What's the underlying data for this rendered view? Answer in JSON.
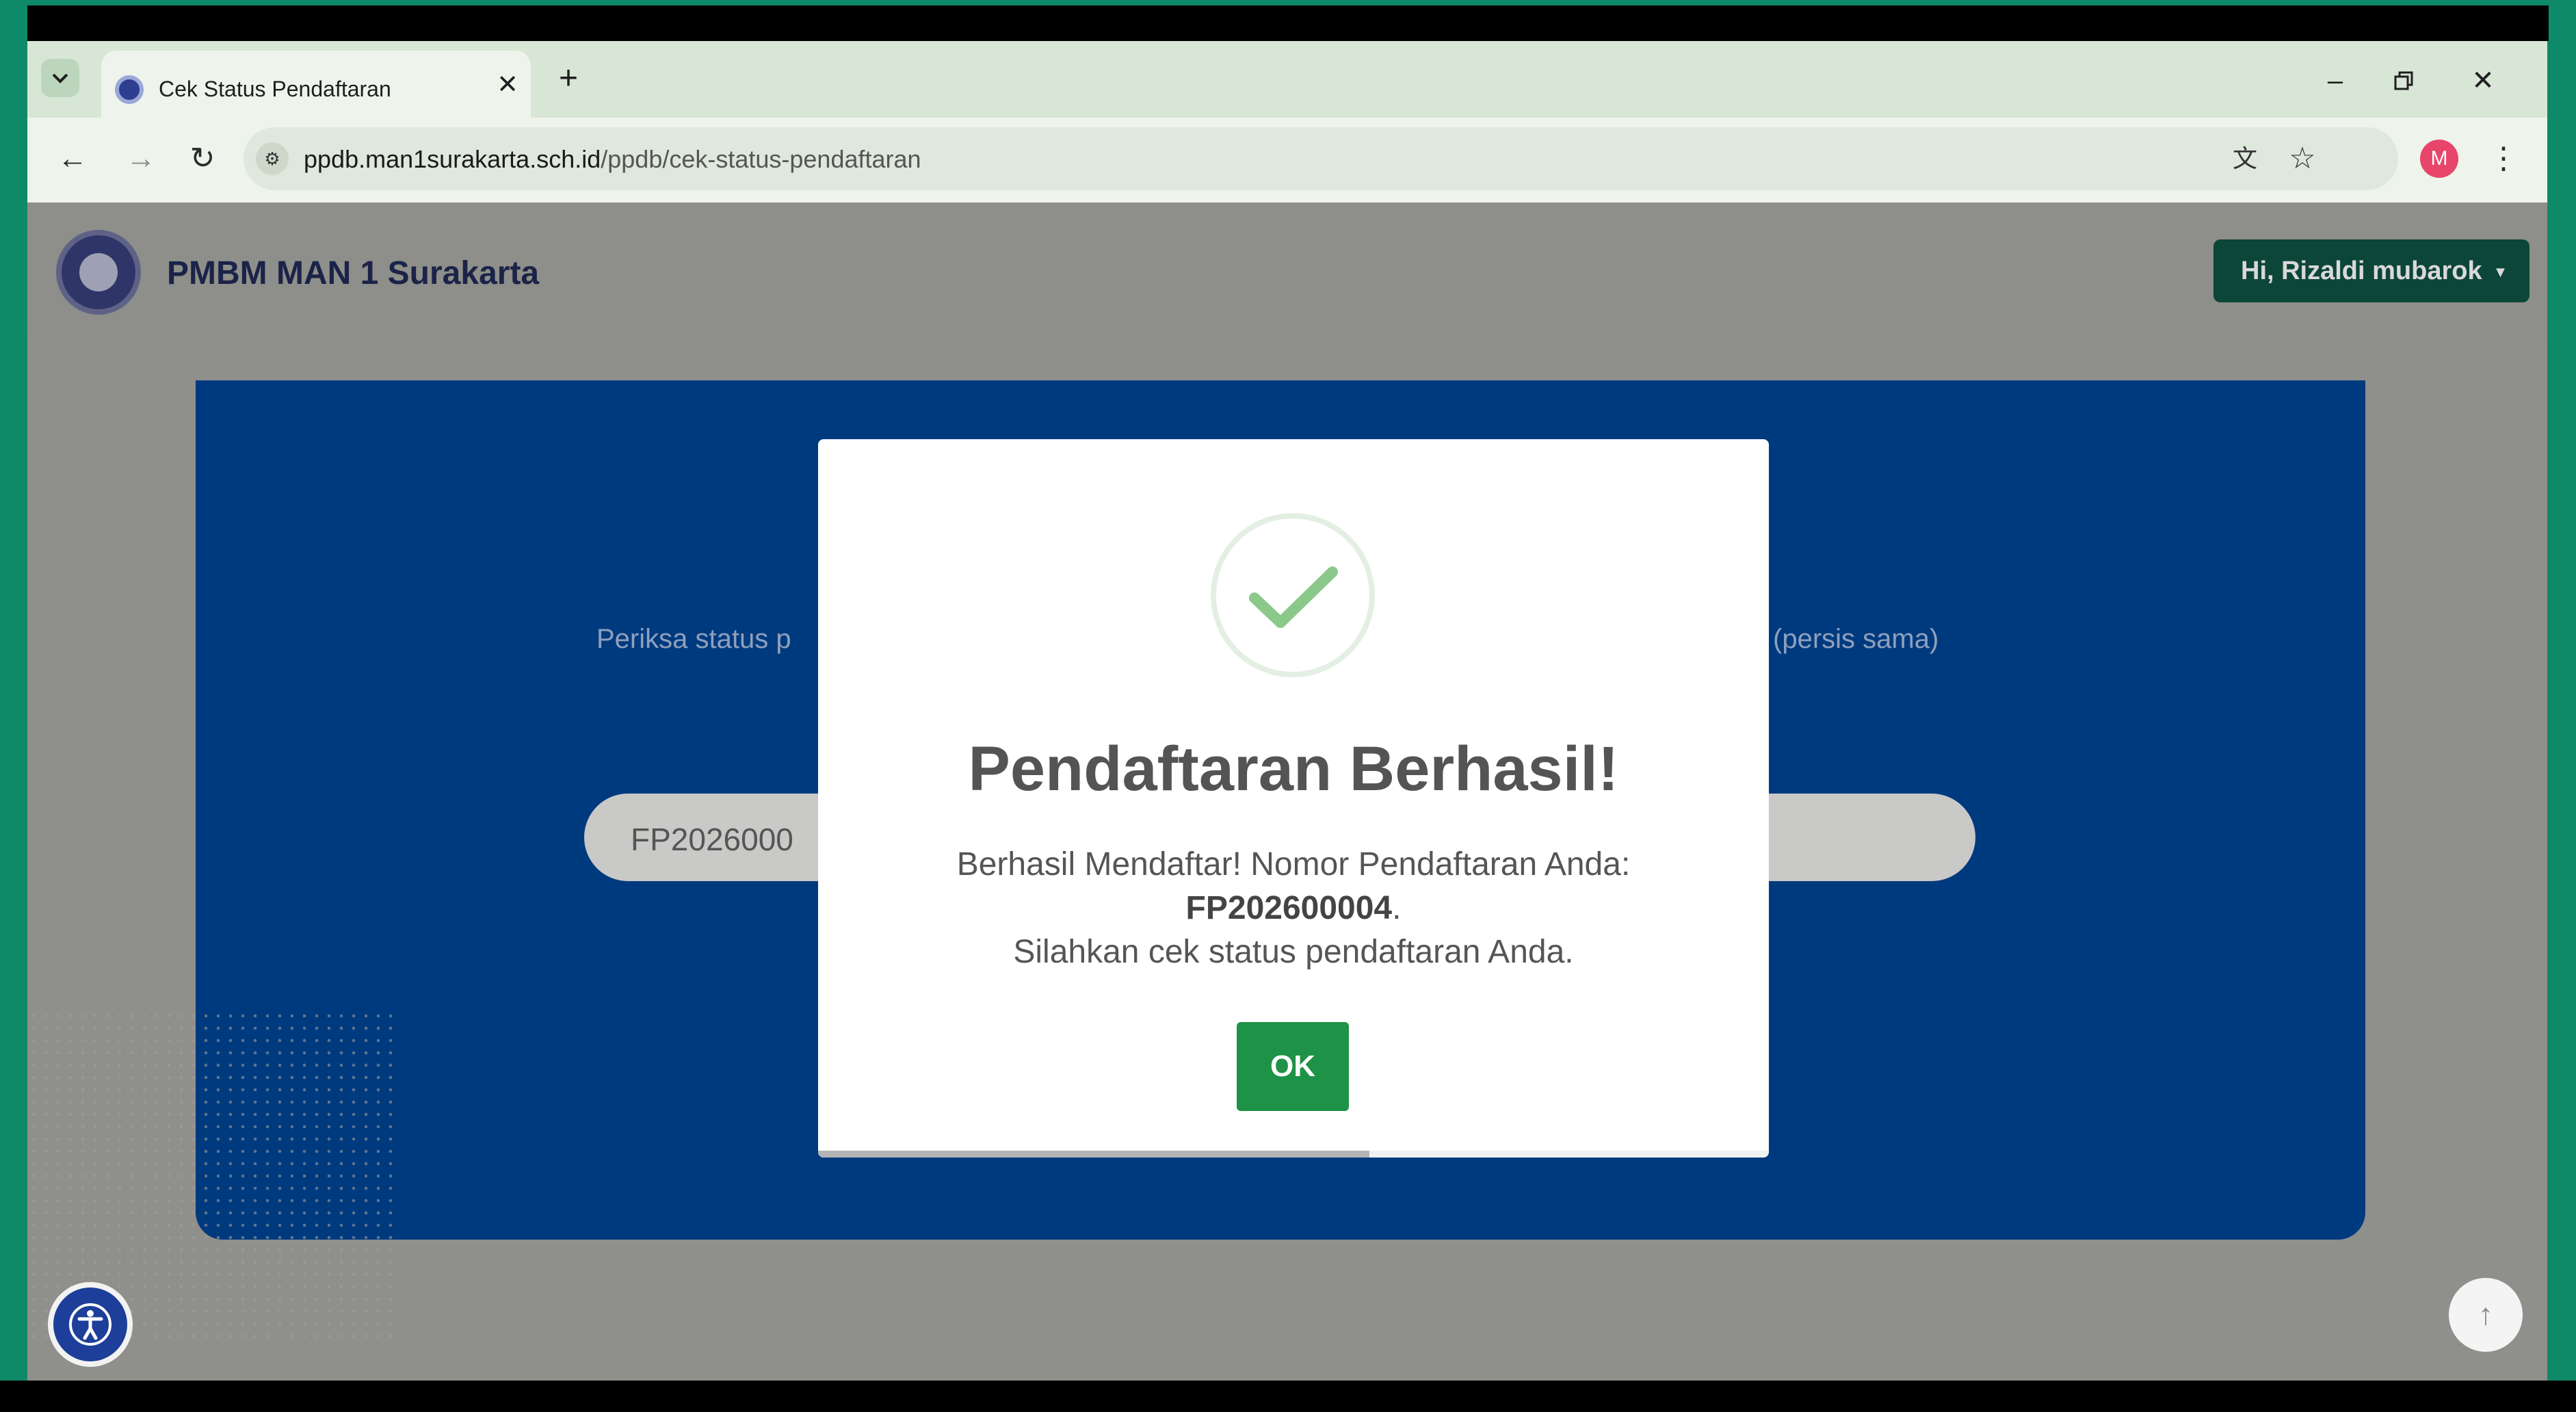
{
  "browser": {
    "tab_title": "Cek Status Pendaftaran",
    "url_host": "ppdb.man1surakarta.sch.id",
    "url_path": "/ppdb/cek-status-pendaftaran",
    "profile_initial": "M"
  },
  "site": {
    "brand": "PMBM MAN 1 Surakarta",
    "user_menu_label": "Hi, Rizaldi mubarok"
  },
  "hero": {
    "description_left": "Periksa status p",
    "description_right": "(persis sama)",
    "search_value": "FP2026000"
  },
  "modal": {
    "title": "Pendaftaran Berhasil!",
    "message_line1": "Berhasil Mendaftar! Nomor Pendaftaran Anda:",
    "registration_number": "FP202600004",
    "message_line2_suffix": ".",
    "message_line3": "Silahkan cek status pendaftaran Anda.",
    "ok_label": "OK",
    "timer_progress_percent": 58
  },
  "icons": {
    "tab_menu": "chevron-down-icon",
    "favicon": "school-emblem-icon",
    "close_tab": "close-icon",
    "new_tab": "plus-icon",
    "minimize": "minimize-icon",
    "restore": "restore-icon",
    "close_window": "close-icon",
    "back": "arrow-left-icon",
    "forward": "arrow-right-icon",
    "reload": "reload-icon",
    "site_info": "tune-icon",
    "translate": "translate-icon",
    "bookmark": "star-icon",
    "menu": "kebab-icon",
    "success": "check-icon",
    "accessibility": "accessibility-icon",
    "scroll_top": "arrow-up-icon"
  },
  "colors": {
    "hero_bg": "#003a7e",
    "ok_button": "#1e9246",
    "success_check": "#8bc98a",
    "user_button": "#0c4638"
  }
}
